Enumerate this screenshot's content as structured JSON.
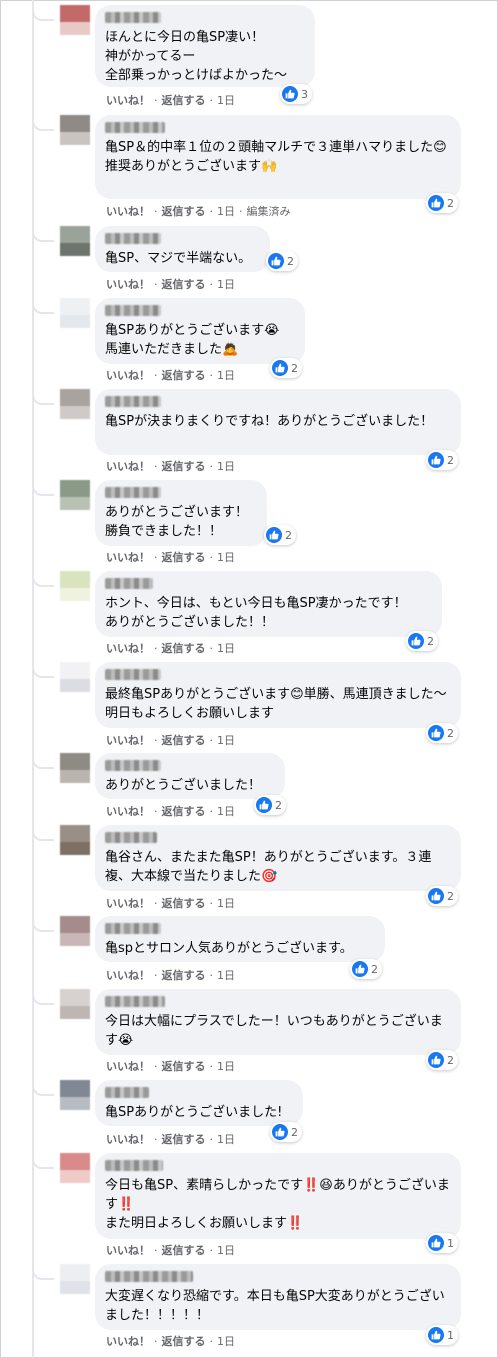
{
  "actions": {
    "like": "いいね！",
    "reply": "返信する",
    "separator": "·"
  },
  "comments": [
    {
      "text": "ほんとに今日の亀SP凄い！\n神がかってるー\n全部乗っかっとけばよかった〜",
      "likes": "3",
      "time": "1日",
      "edited": "",
      "avatar_colors": [
        "#c26a6a",
        "#e7c9c6"
      ]
    },
    {
      "text": "亀SP＆的中率１位の２頭軸マルチで３連単ハマりました😊\n推奨ありがとうございます🙌",
      "likes": "2",
      "time": "1日",
      "edited": "編集済み",
      "avatar_colors": [
        "#8f8a86",
        "#c9c4c0"
      ]
    },
    {
      "text": "亀SP、マジで半端ない。",
      "likes": "2",
      "time": "1日",
      "edited": "",
      "avatar_colors": [
        "#9aa39a",
        "#6d746d"
      ]
    },
    {
      "text": "亀SPありがとうございます😭\n馬連いただきました🙇",
      "likes": "2",
      "time": "1日",
      "edited": "",
      "avatar_colors": [
        "#eef0f3",
        "#e4e7ec"
      ]
    },
    {
      "text": "亀SPが決まりまくりですね！ありがとうございました！",
      "likes": "2",
      "time": "1日",
      "edited": "",
      "avatar_colors": [
        "#a9a3a0",
        "#cfcac7"
      ]
    },
    {
      "text": "ありがとうございます！\n勝負できました！！",
      "likes": "2",
      "time": "1日",
      "edited": "",
      "avatar_colors": [
        "#8a9a86",
        "#b9c1b5"
      ]
    },
    {
      "text": "ホント、今日は、もとい今日も亀SP凄かったです！\nありがとうございました！！",
      "likes": "2",
      "time": "1日",
      "edited": "",
      "avatar_colors": [
        "#d9e3bf",
        "#eef2df"
      ]
    },
    {
      "text": "最終亀SPありがとうございます😊単勝、馬連頂きました〜明日もよろしくお願いします",
      "likes": "2",
      "time": "1日",
      "edited": "",
      "avatar_colors": [
        "#f2f2f4",
        "#dcdde2"
      ]
    },
    {
      "text": "ありがとうございました！",
      "likes": "2",
      "time": "1日",
      "edited": "",
      "avatar_colors": [
        "#8e8a84",
        "#b9b4ad"
      ]
    },
    {
      "text": "亀谷さん、またまた亀SP！ありがとうございます。３連複、大本線で当たりました🎯",
      "likes": "2",
      "time": "1日",
      "edited": "",
      "avatar_colors": [
        "#9a8f86",
        "#7d6f63"
      ]
    },
    {
      "text": "亀spとサロン人気ありがとうございます。",
      "likes": "2",
      "time": "1日",
      "edited": "",
      "avatar_colors": [
        "#a58b8b",
        "#c9b7b7"
      ]
    },
    {
      "text": "今日は大幅にプラスでしたー！いつもありがとうございます😭",
      "likes": "2",
      "time": "1日",
      "edited": "",
      "avatar_colors": [
        "#d7d2d0",
        "#bdb6b3"
      ]
    },
    {
      "text": "亀SPありがとうございました!",
      "likes": "2",
      "time": "1日",
      "edited": "",
      "avatar_colors": [
        "#7f8893",
        "#b7bcc3"
      ]
    },
    {
      "text": "今日も亀SP、素晴らしかったです‼️😆ありがとうございます‼️\nまた明日よろしくお願いします‼️",
      "likes": "1",
      "time": "1日",
      "edited": "",
      "avatar_colors": [
        "#d98a8a",
        "#f0c9c9"
      ]
    },
    {
      "text": "大変遅くなり恐縮です。本日も亀SP大変ありがとうございました！！！！！",
      "likes": "1",
      "time": "1日",
      "edited": "",
      "avatar_colors": [
        "#eceef2",
        "#dfe2e8"
      ]
    }
  ]
}
